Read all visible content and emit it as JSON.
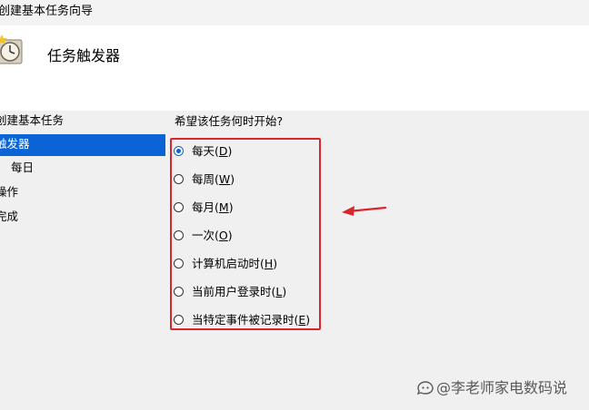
{
  "window": {
    "title": "创建基本任务向导"
  },
  "header": {
    "title": "任务触发器",
    "icon": "clock-task-icon"
  },
  "sidebar": {
    "items": [
      {
        "label": "创建基本任务",
        "selected": false
      },
      {
        "label": "触发器",
        "selected": true
      },
      {
        "label": "每日",
        "selected": false
      },
      {
        "label": "操作",
        "selected": false
      },
      {
        "label": "完成",
        "selected": false
      }
    ]
  },
  "main": {
    "question": "希望该任务何时开始?",
    "options": [
      {
        "text": "每天(",
        "key": "D",
        "tail": ")",
        "checked": true
      },
      {
        "text": "每周(",
        "key": "W",
        "tail": ")",
        "checked": false
      },
      {
        "text": "每月(",
        "key": "M",
        "tail": ")",
        "checked": false
      },
      {
        "text": "一次(",
        "key": "O",
        "tail": ")",
        "checked": false
      },
      {
        "text": "计算机启动时(",
        "key": "H",
        "tail": ")",
        "checked": false
      },
      {
        "text": "当前用户登录时(",
        "key": "L",
        "tail": ")",
        "checked": false
      },
      {
        "text": "当特定事件被记录时(",
        "key": "E",
        "tail": ")",
        "checked": false
      }
    ]
  },
  "annotation": {
    "color": "#d9262c"
  },
  "watermark": {
    "text": "@李老师家电数码说"
  },
  "colors": {
    "selection": "#0a64d6",
    "accent_red": "#d9262c"
  }
}
